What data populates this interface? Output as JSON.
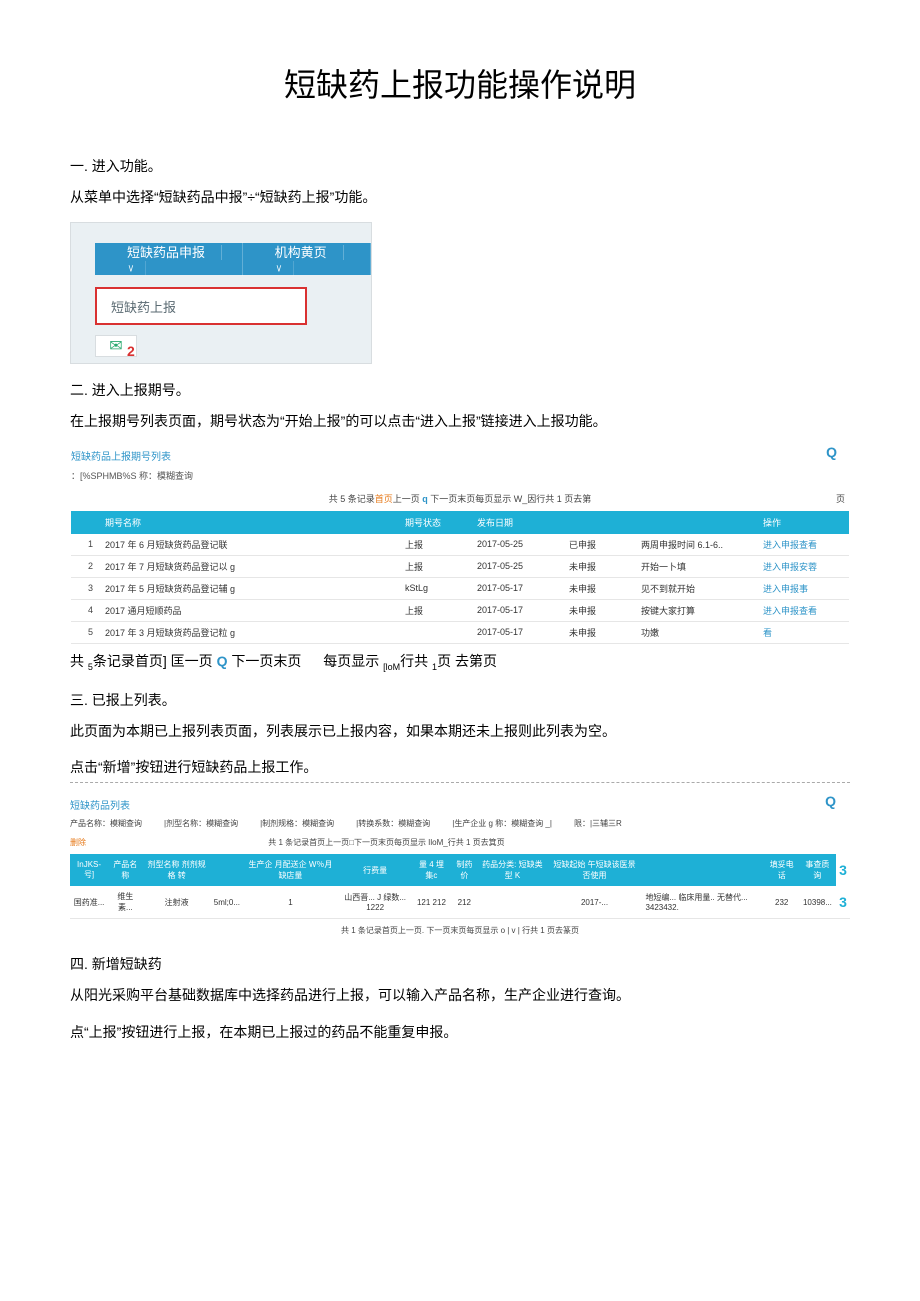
{
  "title": "短缺药上报功能操作说明",
  "sec1": {
    "heading": "一. 进入功能。",
    "text": "从菜单中选择“短缺药品中报”÷“短缺药上报”功能。",
    "menu": {
      "tab1": "短缺药品申报",
      "tab1_chev": "˅",
      "tab2": "机构黄页",
      "tab2_chev": "˅",
      "item": "短缺药上报",
      "badge": "2",
      "envelope": "✉"
    }
  },
  "sec2": {
    "heading": "二. 进入上报期号。",
    "text": "在上报期号列表页面，期号状态为“开始上报”的可以点击“进入上报”链接进入上报功能。",
    "shot": {
      "panel_title": "短缺药品上报期号列表",
      "filter": "：[%SPHMB%S 称：模糊查询",
      "search_icon": "Q",
      "pager_top": {
        "prefix": "共 5 条记录",
        "orange": "首页",
        "prev": "上一页",
        "q": "q",
        "rest": "  下一页末页每页显示 W_因行共 1 页去第",
        "end": "页"
      },
      "columns": {
        "c1": "期号名称",
        "c2": "期号状态",
        "c3": "发布日期",
        "c4": "",
        "c5": "",
        "c6": "操作"
      },
      "rows": [
        {
          "idx": "1",
          "name": "2017 年 6 月短缺货药品登记联",
          "status": "上报",
          "date": "2017-05-25",
          "f1": "已申报",
          "f2": "两周申报时间 6.1-6..",
          "op": "进入申报查看"
        },
        {
          "idx": "2",
          "name": "2017 年 7 月短缺货药品登记以 g",
          "status": "上报",
          "date": "2017-05-25",
          "f1": "未申报",
          "f2": "开始一卜填",
          "op": "进入申报安蓉"
        },
        {
          "idx": "3",
          "name": "2017 年 5 月短缺货药品登记辅 g",
          "status": "kStLg",
          "date": "2017-05-17",
          "f1": "未申报",
          "f2": "见不到就开始",
          "op": "进入申报事"
        },
        {
          "idx": "4",
          "name": "2017 通月短顺药品",
          "status": "上报",
          "date": "2017-05-17",
          "f1": "未申报",
          "f2": "按键大家打算",
          "op": "进入申报查看"
        },
        {
          "idx": "5",
          "name": "2017 年 3 月短缺货药品登记粒 g",
          "status": "",
          "date": "2017-05-17",
          "f1": "未申报",
          "f2": "功嫩",
          "op": "看"
        }
      ]
    },
    "pager_line": {
      "a": "共 ",
      "sub1": "5",
      "b": "条记录首页]  匡一页 ",
      "q": "Q",
      "c": " 下一页末页",
      "gap": "",
      "d": "   每页显示 ",
      "sub2": "[loM",
      "e": "行共 ",
      "sub3": "1",
      "f": "页",
      "g": "     去第页"
    }
  },
  "sec3": {
    "heading": "三. 已报上列表。",
    "text1": "此页面为本期已上报列表页面，列表展示已上报内容，如果本期还未上报则此列表为空。",
    "text2": "点击“新增”按钮进行短缺药品上报工作。",
    "shot": {
      "panel_title": "短缺药品列表",
      "search_icon": "Q",
      "filters": [
        "产品名称：模糊查询",
        "|剂型名称：模糊查询",
        "|制剂规格：模糊查询",
        "|转换系数：模糊查询",
        "|生产企业 g 称：模糊查询     _|",
        "限：|三辅三R"
      ],
      "delete": "删除",
      "pager_top": "共 1 条记录首页上一页□下一页末页每页显示 IloM_行共 1 页去箕页",
      "columns": [
        "InJKS-号]",
        "产品名称",
        "剂型名称 剂剂规格 转",
        "",
        "生产企 月配送企 W％月缺店量",
        "行费量",
        "量 4 埋集c",
        "制药价",
        "药品分类: 短缺类型 K",
        "短缺起始 午短缺该医景否使用",
        "",
        "填妥电话",
        "事查质询",
        ""
      ],
      "row": {
        "c1": "国药准...",
        "c2": "维生素...",
        "c3": "注射液",
        "c4": "5ml;0...",
        "c5": "1",
        "c6": "山西晋...",
        "c7": "J 绿数...",
        "c8": "1222",
        "c9": "121",
        "c10": "212",
        "c11": "212",
        "c12": "",
        "c13": "2017-...",
        "c14": "地短编...  临床用量.. 无替代...  3423432.",
        "c15": "232",
        "c16": "10398...",
        "icon": "3"
      },
      "hdr_icon": "3",
      "footer": "共 1 条记录首页上一页.  下一页末页每页显示 o | v | 行共 1 页去篆页"
    }
  },
  "sec4": {
    "heading": "四. 新增短缺药",
    "text1": "从阳光采购平台基础数据库中选择药品进行上报，可以输入产品名称，生产企业进行查询。",
    "text2": "点“上报”按钮进行上报，在本期已上报过的药品不能重复申报。"
  }
}
